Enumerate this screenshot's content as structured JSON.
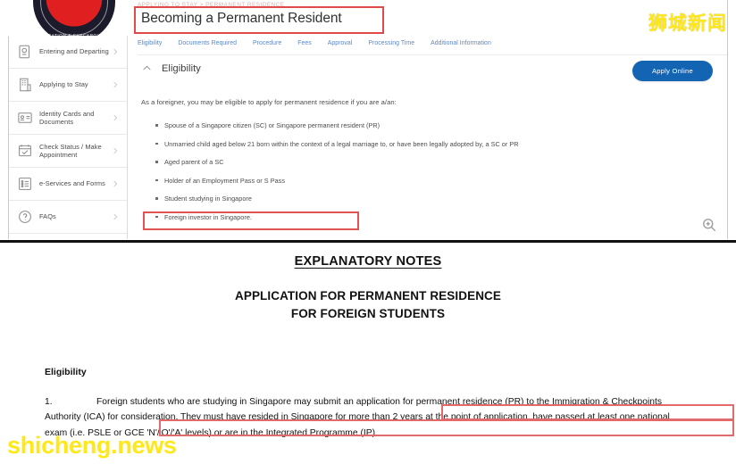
{
  "web_panel": {
    "breadcrumb": "APPLYING TO STAY > PERMANENT RESIDENCE",
    "page_title": "Becoming a Permanent Resident",
    "logo_name": "ica-crest-logo",
    "crest_text": "IMMIGRATION & CHECKPOINTS AUTHORITY",
    "sidebar": {
      "items": [
        {
          "label": "Entering and Departing",
          "icon": "passport-icon"
        },
        {
          "label": "Applying to Stay",
          "icon": "building-icon"
        },
        {
          "label": "Identity Cards and Documents",
          "icon": "id-card-icon"
        },
        {
          "label": "Check Status / Make Appointment",
          "icon": "calendar-check-icon"
        },
        {
          "label": "e-Services and Forms",
          "icon": "list-form-icon"
        },
        {
          "label": "FAQs",
          "icon": "question-circle-icon"
        }
      ],
      "chevron_icon": "chevron-right-icon"
    },
    "tabs": [
      {
        "label": "Eligibility"
      },
      {
        "label": "Documents Required"
      },
      {
        "label": "Procedure"
      },
      {
        "label": "Fees"
      },
      {
        "label": "Approval"
      },
      {
        "label": "Processing Time"
      },
      {
        "label": "Additional Information"
      }
    ],
    "section": {
      "title": "Eligibility",
      "collapse_icon": "chevron-up-icon"
    },
    "apply_button": {
      "label": "Apply Online",
      "color": "#1464b4"
    },
    "lead": "As a foreigner, you may be eligible to apply for permanent residence if you are a/an:",
    "bullets": [
      "Spouse of a Singapore citizen (SC) or Singapore permanent resident (PR)",
      "Unmarried child aged below 21 born within the context of a legal marriage to, or have been legally adopted by, a SC or PR",
      "Aged parent of a SC",
      "Holder of an Employment Pass or S Pass",
      "Student studying in Singapore",
      "Foreign investor in Singapore."
    ],
    "magnifier_icon": "zoom-in-icon"
  },
  "document": {
    "heading": "EXPLANATORY NOTES",
    "subheading_line1": "APPLICATION FOR PERMANENT RESIDENCE",
    "subheading_line2": "FOR FOREIGN STUDENTS",
    "section_label": "Eligibility",
    "paragraph_number": "1.",
    "paragraph": "Foreign students who are studying in Singapore may submit an application for permanent residence (PR) to the Immigration & Checkpoints Authority (ICA) for consideration. They must have resided in Singapore for more than 2 years at the point of application, have passed at least one national exam (i.e. PSLE or GCE 'N'/'O'/'A' levels) or are in the Integrated Programme (IP)."
  },
  "annotations": {
    "highlight_color": "#e24a4a",
    "title_box": "Becoming a Permanent Resident",
    "bullet_box": "Foreign investor in Singapore.",
    "doc_box_1": "resided in Singapore for more than 2 years at",
    "doc_box_2": "have passed at least one national exam (i.e. PSLE or GCE 'N'/'O'/'A' levels) or are in the Integrated"
  },
  "watermarks": {
    "top_right": "狮城新闻",
    "bottom_left": "shicheng.news",
    "color": "#ffe81a"
  }
}
